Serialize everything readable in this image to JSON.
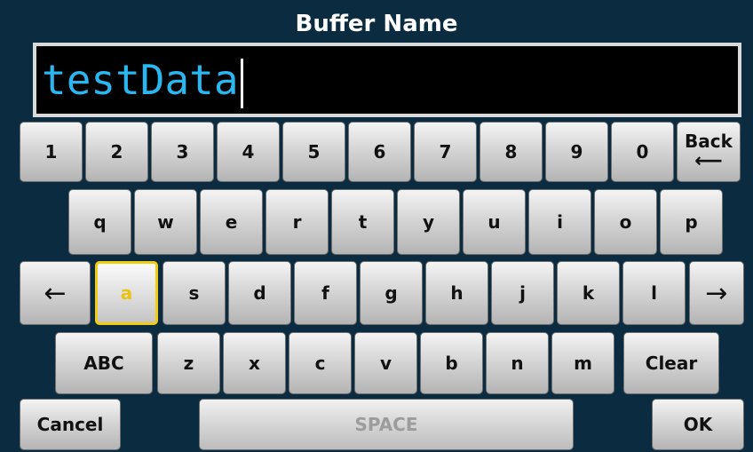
{
  "title": "Buffer Name",
  "input": {
    "value": "testData"
  },
  "rows": {
    "digits": [
      "1",
      "2",
      "3",
      "4",
      "5",
      "6",
      "7",
      "8",
      "9",
      "0"
    ],
    "back_label": "Back",
    "back_arrow": "⟵",
    "qwerty": [
      "q",
      "w",
      "e",
      "r",
      "t",
      "y",
      "u",
      "i",
      "o",
      "p"
    ],
    "left_arrow": "←",
    "home": [
      "a",
      "s",
      "d",
      "f",
      "g",
      "h",
      "j",
      "k",
      "l"
    ],
    "right_arrow": "→",
    "abc_label": "ABC",
    "bottom": [
      "z",
      "x",
      "c",
      "v",
      "b",
      "n",
      "m"
    ],
    "clear_label": "Clear",
    "cancel_label": "Cancel",
    "space_label": "SPACE",
    "ok_label": "OK"
  },
  "selected_key": "a",
  "colors": {
    "background": "#0b2c40",
    "input_text": "#2ab7f0",
    "selected_border": "#f2cc12",
    "key_text": "#111111",
    "space_text": "#9c9c9c"
  }
}
